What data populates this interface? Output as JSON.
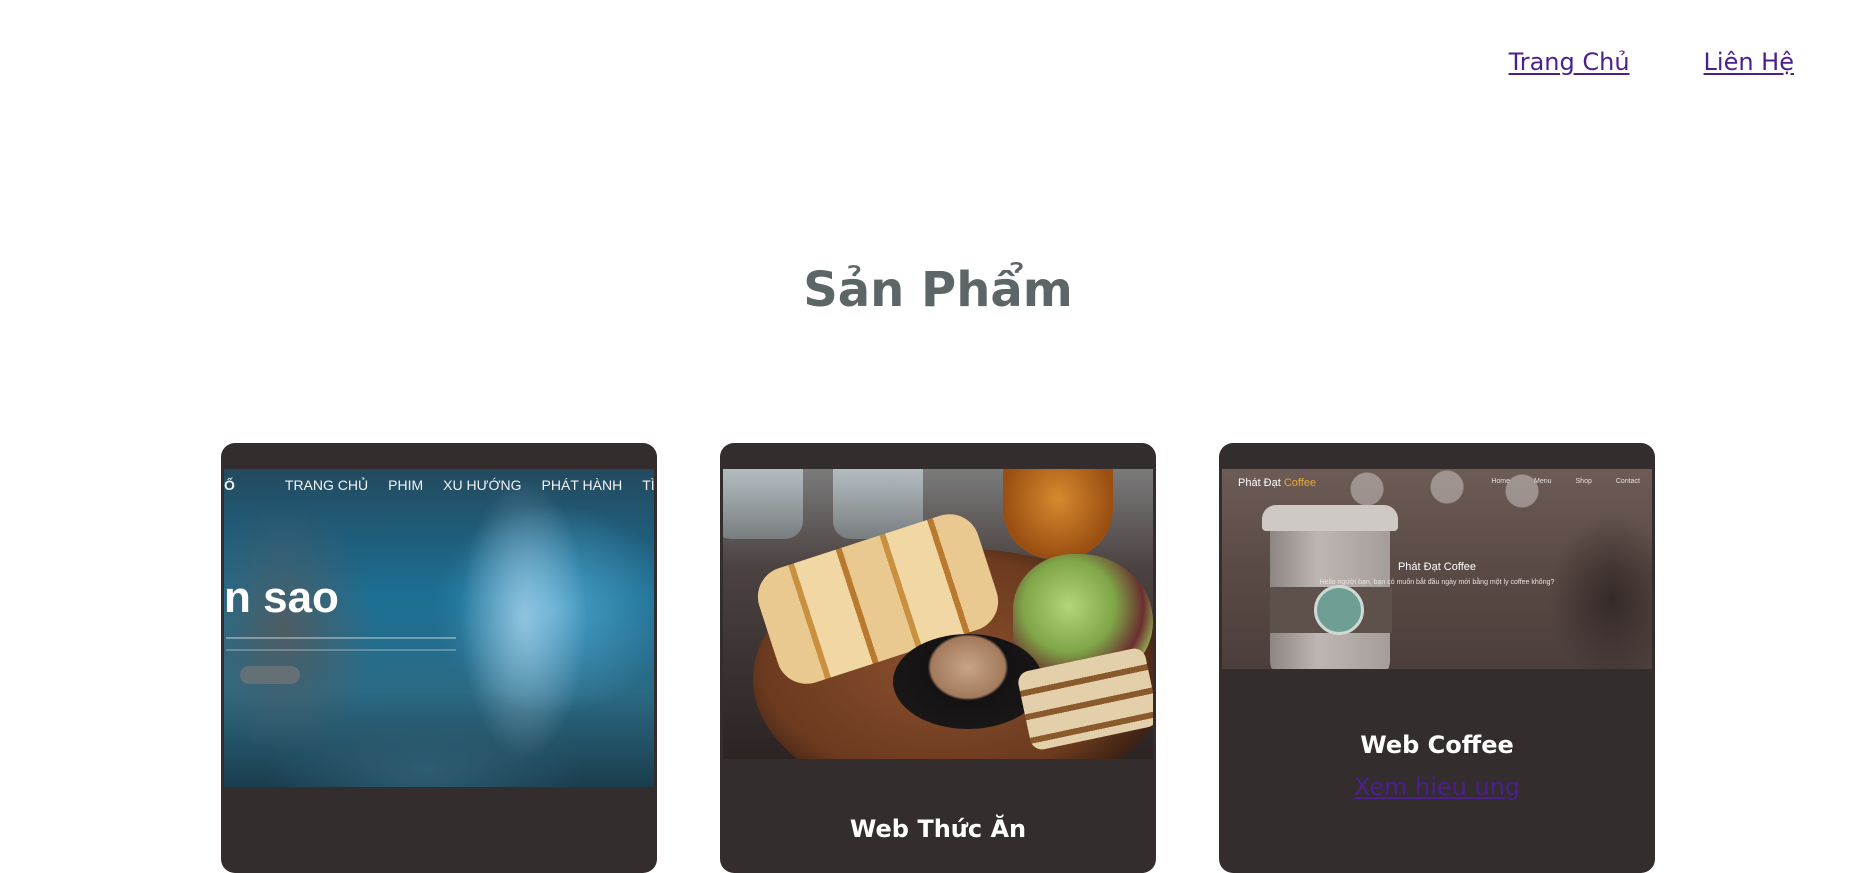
{
  "nav": {
    "items": [
      {
        "label": "Trang Chủ"
      },
      {
        "label": "Liên Hệ"
      }
    ],
    "link_color": "#4b1f8f"
  },
  "section": {
    "title": "Sản Phẩm"
  },
  "cards": [
    {
      "title": "",
      "link": "",
      "thumbnail": {
        "type": "space-movie-site-screenshot",
        "logo": "Ố",
        "nav": [
          "TRANG CHỦ",
          "PHIM",
          "XU HƯỚNG",
          "PHÁT HÀNH",
          "TÌM KIẾ"
        ],
        "hero": "n sao"
      }
    },
    {
      "title": "Web Thức Ăn",
      "link": "",
      "thumbnail": {
        "type": "food-photo"
      }
    },
    {
      "title": "Web Coffee",
      "link": "Xem hieu ung",
      "thumbnail": {
        "type": "coffee-site-screenshot",
        "brand_prefix": "Phát Đạt ",
        "brand_accent": "Coffee",
        "menu": [
          "Home",
          "Menu",
          "Shop",
          "Contact"
        ],
        "title": "Phát Đạt Coffee",
        "subtitle": "Hello người bạn, bạn có muốn bắt đầu ngày mới bằng một ly coffee không?"
      }
    }
  ],
  "colors": {
    "card_background": "#342d2e",
    "title_text": "#5c6666",
    "accent_orange": "#e7a73a"
  }
}
